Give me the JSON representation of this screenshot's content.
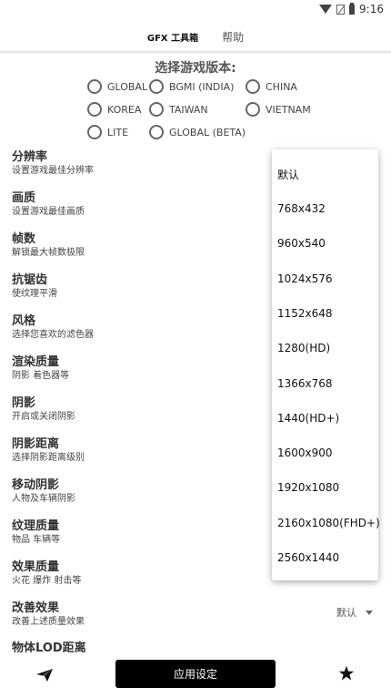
{
  "status_bar": {
    "time": "9:16"
  },
  "tabs": [
    {
      "label": "GFX 工具箱"
    },
    {
      "label": "帮助"
    }
  ],
  "version_section": {
    "title": "选择游戏版本:",
    "options": [
      "GLOBAL",
      "BGMI (INDIA)",
      "CHINA",
      "KOREA",
      "TAIWAN",
      "VIETNAM",
      "LITE",
      "GLOBAL (BETA)"
    ]
  },
  "settings": [
    {
      "title": "分辨率",
      "subtitle": "设置游戏最佳分辨率"
    },
    {
      "title": "画质",
      "subtitle": "设置游戏最佳画质"
    },
    {
      "title": "帧数",
      "subtitle": "解锁最大帧数极限"
    },
    {
      "title": "抗锯齿",
      "subtitle": "使纹理平滑"
    },
    {
      "title": "风格",
      "subtitle": "选择您喜欢的滤色器"
    },
    {
      "title": "渲染质量",
      "subtitle": "阴影 着色器等"
    },
    {
      "title": "阴影",
      "subtitle": "开启或关闭阴影"
    },
    {
      "title": "阴影距离",
      "subtitle": "选择阴影距离级别"
    },
    {
      "title": "移动阴影",
      "subtitle": "人物及车辆阴影"
    },
    {
      "title": "纹理质量",
      "subtitle": "物品 车辆等"
    },
    {
      "title": "效果质量",
      "subtitle": "火花 爆炸 射击等"
    },
    {
      "title": "改善效果",
      "subtitle": "改善上述质量效果"
    }
  ],
  "improve_dropdown_value": "默认",
  "cutoff_row_title": "物体LOD距离",
  "resolution_menu": [
    "默认",
    "768x432",
    "960x540",
    "1024x576",
    "1152x648",
    "1280(HD)",
    "1366x768",
    "1440(HD+)",
    "1600x900",
    "1920x1080",
    "2160x1080(FHD+)",
    "2560x1440"
  ],
  "bottom_bar": {
    "apply_label": "应用设定"
  }
}
